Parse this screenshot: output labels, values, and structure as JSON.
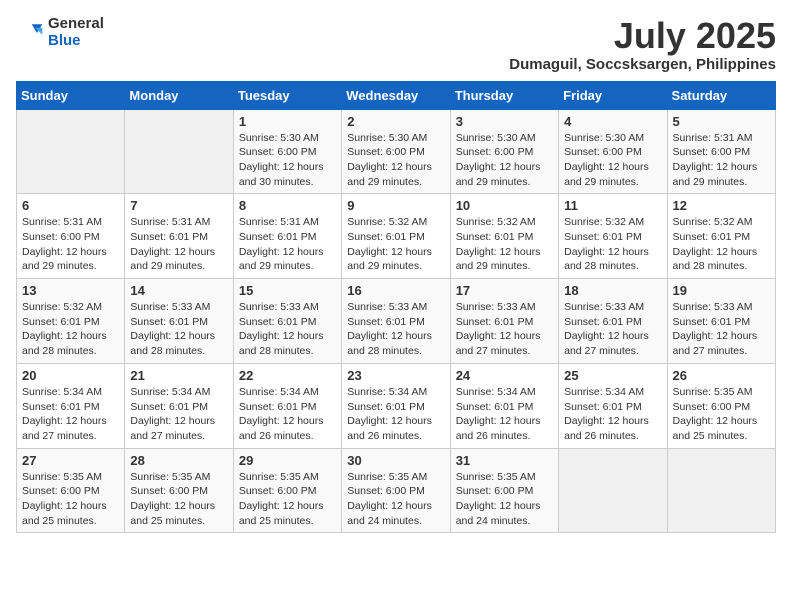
{
  "logo": {
    "general": "General",
    "blue": "Blue"
  },
  "title": "July 2025",
  "subtitle": "Dumaguil, Soccsksargen, Philippines",
  "headers": [
    "Sunday",
    "Monday",
    "Tuesday",
    "Wednesday",
    "Thursday",
    "Friday",
    "Saturday"
  ],
  "weeks": [
    [
      {
        "day": "",
        "info": ""
      },
      {
        "day": "",
        "info": ""
      },
      {
        "day": "1",
        "info": "Sunrise: 5:30 AM\nSunset: 6:00 PM\nDaylight: 12 hours\nand 30 minutes."
      },
      {
        "day": "2",
        "info": "Sunrise: 5:30 AM\nSunset: 6:00 PM\nDaylight: 12 hours\nand 29 minutes."
      },
      {
        "day": "3",
        "info": "Sunrise: 5:30 AM\nSunset: 6:00 PM\nDaylight: 12 hours\nand 29 minutes."
      },
      {
        "day": "4",
        "info": "Sunrise: 5:30 AM\nSunset: 6:00 PM\nDaylight: 12 hours\nand 29 minutes."
      },
      {
        "day": "5",
        "info": "Sunrise: 5:31 AM\nSunset: 6:00 PM\nDaylight: 12 hours\nand 29 minutes."
      }
    ],
    [
      {
        "day": "6",
        "info": "Sunrise: 5:31 AM\nSunset: 6:00 PM\nDaylight: 12 hours\nand 29 minutes."
      },
      {
        "day": "7",
        "info": "Sunrise: 5:31 AM\nSunset: 6:01 PM\nDaylight: 12 hours\nand 29 minutes."
      },
      {
        "day": "8",
        "info": "Sunrise: 5:31 AM\nSunset: 6:01 PM\nDaylight: 12 hours\nand 29 minutes."
      },
      {
        "day": "9",
        "info": "Sunrise: 5:32 AM\nSunset: 6:01 PM\nDaylight: 12 hours\nand 29 minutes."
      },
      {
        "day": "10",
        "info": "Sunrise: 5:32 AM\nSunset: 6:01 PM\nDaylight: 12 hours\nand 29 minutes."
      },
      {
        "day": "11",
        "info": "Sunrise: 5:32 AM\nSunset: 6:01 PM\nDaylight: 12 hours\nand 28 minutes."
      },
      {
        "day": "12",
        "info": "Sunrise: 5:32 AM\nSunset: 6:01 PM\nDaylight: 12 hours\nand 28 minutes."
      }
    ],
    [
      {
        "day": "13",
        "info": "Sunrise: 5:32 AM\nSunset: 6:01 PM\nDaylight: 12 hours\nand 28 minutes."
      },
      {
        "day": "14",
        "info": "Sunrise: 5:33 AM\nSunset: 6:01 PM\nDaylight: 12 hours\nand 28 minutes."
      },
      {
        "day": "15",
        "info": "Sunrise: 5:33 AM\nSunset: 6:01 PM\nDaylight: 12 hours\nand 28 minutes."
      },
      {
        "day": "16",
        "info": "Sunrise: 5:33 AM\nSunset: 6:01 PM\nDaylight: 12 hours\nand 28 minutes."
      },
      {
        "day": "17",
        "info": "Sunrise: 5:33 AM\nSunset: 6:01 PM\nDaylight: 12 hours\nand 27 minutes."
      },
      {
        "day": "18",
        "info": "Sunrise: 5:33 AM\nSunset: 6:01 PM\nDaylight: 12 hours\nand 27 minutes."
      },
      {
        "day": "19",
        "info": "Sunrise: 5:33 AM\nSunset: 6:01 PM\nDaylight: 12 hours\nand 27 minutes."
      }
    ],
    [
      {
        "day": "20",
        "info": "Sunrise: 5:34 AM\nSunset: 6:01 PM\nDaylight: 12 hours\nand 27 minutes."
      },
      {
        "day": "21",
        "info": "Sunrise: 5:34 AM\nSunset: 6:01 PM\nDaylight: 12 hours\nand 27 minutes."
      },
      {
        "day": "22",
        "info": "Sunrise: 5:34 AM\nSunset: 6:01 PM\nDaylight: 12 hours\nand 26 minutes."
      },
      {
        "day": "23",
        "info": "Sunrise: 5:34 AM\nSunset: 6:01 PM\nDaylight: 12 hours\nand 26 minutes."
      },
      {
        "day": "24",
        "info": "Sunrise: 5:34 AM\nSunset: 6:01 PM\nDaylight: 12 hours\nand 26 minutes."
      },
      {
        "day": "25",
        "info": "Sunrise: 5:34 AM\nSunset: 6:01 PM\nDaylight: 12 hours\nand 26 minutes."
      },
      {
        "day": "26",
        "info": "Sunrise: 5:35 AM\nSunset: 6:00 PM\nDaylight: 12 hours\nand 25 minutes."
      }
    ],
    [
      {
        "day": "27",
        "info": "Sunrise: 5:35 AM\nSunset: 6:00 PM\nDaylight: 12 hours\nand 25 minutes."
      },
      {
        "day": "28",
        "info": "Sunrise: 5:35 AM\nSunset: 6:00 PM\nDaylight: 12 hours\nand 25 minutes."
      },
      {
        "day": "29",
        "info": "Sunrise: 5:35 AM\nSunset: 6:00 PM\nDaylight: 12 hours\nand 25 minutes."
      },
      {
        "day": "30",
        "info": "Sunrise: 5:35 AM\nSunset: 6:00 PM\nDaylight: 12 hours\nand 24 minutes."
      },
      {
        "day": "31",
        "info": "Sunrise: 5:35 AM\nSunset: 6:00 PM\nDaylight: 12 hours\nand 24 minutes."
      },
      {
        "day": "",
        "info": ""
      },
      {
        "day": "",
        "info": ""
      }
    ]
  ]
}
